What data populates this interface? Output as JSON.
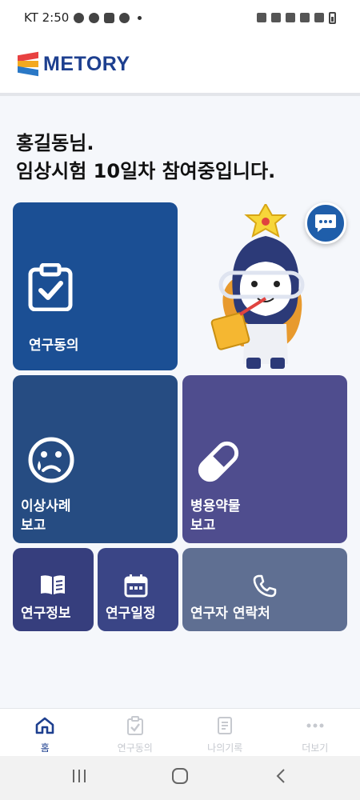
{
  "status_bar": {
    "time": "KT 2:50"
  },
  "header": {
    "logo_text": "METORY"
  },
  "greeting": {
    "line1": "홍길동님.",
    "line2": "임상시험 10일차 참여중입니다."
  },
  "tiles": {
    "consent": {
      "label": "연구동의",
      "icon": "clipboard-check-icon"
    },
    "adverse": {
      "label": "이상사례\n보고",
      "icon": "sad-face-icon"
    },
    "concomitant": {
      "label": "병용약물\n보고",
      "icon": "pill-icon"
    },
    "info": {
      "label": "연구정보",
      "icon": "book-icon"
    },
    "schedule": {
      "label": "연구일정",
      "icon": "calendar-icon"
    },
    "contact": {
      "label": "연구자 연락처",
      "icon": "phone-icon"
    }
  },
  "chat_button": {
    "icon": "chat-bubble-icon"
  },
  "bottom_nav": [
    {
      "label": "홈",
      "icon": "home-icon",
      "active": true
    },
    {
      "label": "연구동의",
      "icon": "clipboard-check-icon",
      "active": false
    },
    {
      "label": "나의기록",
      "icon": "record-icon",
      "active": false
    },
    {
      "label": "더보기",
      "icon": "more-icon",
      "active": false
    }
  ],
  "colors": {
    "brand": "#1d3f8f",
    "tile_consent": "#1b4f94",
    "tile_adverse": "#264c82",
    "tile_concomitant": "#4f4d8e",
    "tile_info": "#363e7d",
    "tile_schedule": "#3a4586",
    "tile_contact": "#5f6f92"
  }
}
